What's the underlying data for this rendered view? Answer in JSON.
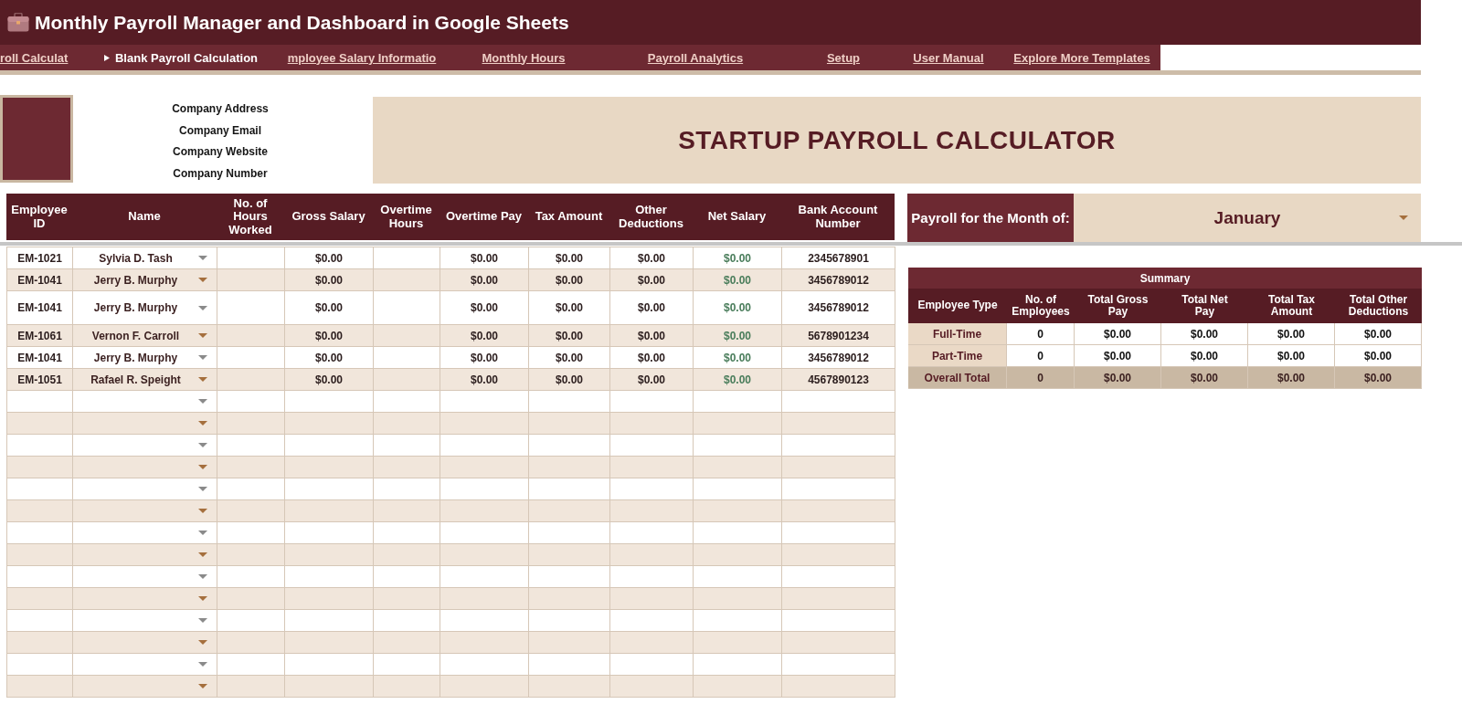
{
  "header": {
    "title": "Monthly Payroll Manager and Dashboard in Google Sheets"
  },
  "nav_tabs": [
    {
      "label": "roll Calculat",
      "selected": false
    },
    {
      "label": "Blank Payroll Calculation",
      "selected": true
    },
    {
      "label": "mployee Salary Informatio",
      "selected": false
    },
    {
      "label": "Monthly Hours",
      "selected": false
    },
    {
      "label": "Payroll Analytics",
      "selected": false
    },
    {
      "label": "Setup",
      "selected": false
    },
    {
      "label": "User Manual",
      "selected": false
    },
    {
      "label": "Explore More Templates",
      "selected": false
    }
  ],
  "company": {
    "details": [
      "Company Address",
      "Company Email",
      "Company Website",
      "Company Number"
    ]
  },
  "banner": {
    "title": "STARTUP PAYROLL CALCULATOR"
  },
  "payroll_table": {
    "columns": [
      "Employee ID",
      "Name",
      "No. of Hours Worked",
      "Gross Salary",
      "Overtime Hours",
      "Overtime Pay",
      "Tax Amount",
      "Other Deductions",
      "Net Salary",
      "Bank Account Number"
    ],
    "rows": [
      {
        "employee_id": "EM-1021",
        "name": "Sylvia D. Tash",
        "name_dropdown": true,
        "gross_salary": "$0.00",
        "overtime_pay": "$0.00",
        "tax_amount": "$0.00",
        "other_deductions": "$0.00",
        "net_salary": "$0.00",
        "bank_account_number": "2345678901"
      },
      {
        "employee_id": "EM-1041",
        "name": "Jerry B. Murphy",
        "name_dropdown": true,
        "gross_salary": "$0.00",
        "overtime_pay": "$0.00",
        "tax_amount": "$0.00",
        "other_deductions": "$0.00",
        "net_salary": "$0.00",
        "bank_account_number": "3456789012"
      },
      {
        "employee_id": "EM-1041",
        "name": "Jerry B. Murphy",
        "name_dropdown": true,
        "gross_salary": "$0.00",
        "overtime_pay": "$0.00",
        "tax_amount": "$0.00",
        "other_deductions": "$0.00",
        "net_salary": "$0.00",
        "bank_account_number": "3456789012"
      },
      {
        "employee_id": "EM-1061",
        "name": "Vernon F. Carroll",
        "name_dropdown": true,
        "gross_salary": "$0.00",
        "overtime_pay": "$0.00",
        "tax_amount": "$0.00",
        "other_deductions": "$0.00",
        "net_salary": "$0.00",
        "bank_account_number": "5678901234"
      },
      {
        "employee_id": "EM-1041",
        "name": "Jerry B. Murphy",
        "name_dropdown": true,
        "gross_salary": "$0.00",
        "overtime_pay": "$0.00",
        "tax_amount": "$0.00",
        "other_deductions": "$0.00",
        "net_salary": "$0.00",
        "bank_account_number": "3456789012"
      },
      {
        "employee_id": "EM-1051",
        "name": "Rafael R. Speight",
        "name_dropdown": true,
        "gross_salary": "$0.00",
        "overtime_pay": "$0.00",
        "tax_amount": "$0.00",
        "other_deductions": "$0.00",
        "net_salary": "$0.00",
        "bank_account_number": "4567890123"
      },
      {
        "name_dropdown": true
      },
      {
        "name_dropdown": true
      },
      {
        "name_dropdown": true
      },
      {
        "name_dropdown": true
      },
      {
        "name_dropdown": true
      },
      {
        "name_dropdown": true
      },
      {
        "name_dropdown": true
      },
      {
        "name_dropdown": true
      },
      {
        "name_dropdown": true
      },
      {
        "name_dropdown": true
      },
      {
        "name_dropdown": true
      },
      {
        "name_dropdown": true
      },
      {
        "name_dropdown": true
      },
      {
        "name_dropdown": true
      }
    ]
  },
  "month_selector": {
    "label": "Payroll for the Month of:",
    "value": "January"
  },
  "summary": {
    "title": "Summary",
    "columns": [
      "Employee Type",
      "No. of Employees",
      "Total Gross Pay",
      "Total Net Pay",
      "Total Tax Amount",
      "Total Other Deductions"
    ],
    "rows": [
      {
        "kind": "type",
        "employee_type": "Full-Time",
        "values": [
          "0",
          "$0.00",
          "$0.00",
          "$0.00",
          "$0.00"
        ]
      },
      {
        "kind": "type",
        "employee_type": "Part-Time",
        "values": [
          "0",
          "$0.00",
          "$0.00",
          "$0.00",
          "$0.00"
        ]
      },
      {
        "kind": "total",
        "employee_type": "Overall Total",
        "values": [
          "0",
          "$0.00",
          "$0.00",
          "$0.00",
          "$0.00"
        ]
      }
    ]
  }
}
